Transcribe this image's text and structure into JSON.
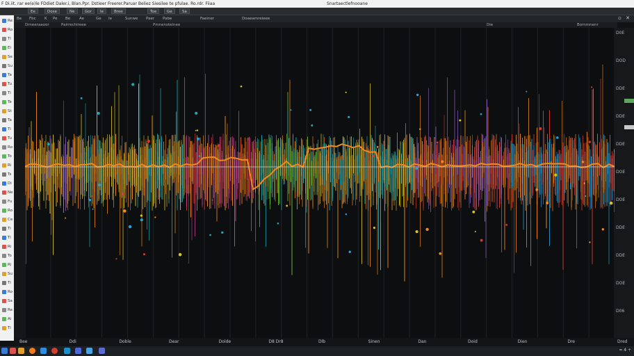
{
  "menubar": {
    "left_text": "F Di.iit. rar ee(e)le FDdiet Daler.i, Blan.Ppr. Dstieer Freerer.Paruar Beliez Siesilee te pfulae. Ro.rdr. Fiiaa",
    "center_title": "Snartaectlefnooane"
  },
  "toolbar": {
    "buttons": [
      "Ee",
      "Dose",
      "Ne",
      "Gor",
      "Ie",
      "Bree",
      "Toe",
      "Ge",
      "Sa"
    ]
  },
  "toolbar2": {
    "items": [
      "Be",
      "Fbc",
      "K",
      "Pe",
      "Be",
      "Ae",
      "Ge",
      "Ie",
      "Sunwe",
      "Paer",
      "Pabe",
      "Faeiner",
      "Doaeamreieee"
    ]
  },
  "ruler": {
    "left_label": "Drneeraaoor",
    "left_label2": "Pairrechireee",
    "center_label": "Pmnenstelnee",
    "mid_label": "Die",
    "right_label": "Bornmnenr"
  },
  "leftbar": {
    "labels": [
      "Re",
      "Ro",
      "Ti",
      "Ei",
      "Se",
      "Su",
      "Ta",
      "Tu",
      "Ti",
      "Te",
      "St",
      "Ta",
      "Ti",
      "Tu",
      "Ro",
      "To",
      "Ri",
      "Ts",
      "Di",
      "Ne",
      "Fu",
      "Ro",
      "Ce",
      "Ti",
      "Ti",
      "Ri",
      "To",
      "Ri",
      "Su",
      "Ti",
      "Ro",
      "Sa",
      "Re",
      "Ai",
      "Ti"
    ]
  },
  "rightpanel": {
    "labels": [
      "D0E",
      "DOD",
      "DDE",
      "DDE",
      "DDE",
      "DOE",
      "DOE",
      "DDE",
      "DDE",
      "DOE",
      "D06"
    ]
  },
  "bottom_axis": {
    "labels": [
      "Bee",
      "Ddi",
      "Doble",
      "Dear",
      "Dolde",
      "D8 Dr8",
      "Dlb",
      "Sinen",
      "Dan",
      "Doid",
      "Dien",
      "Dre",
      "Dred"
    ]
  },
  "taskbar": {
    "right_text": "≈ 4 ÷"
  },
  "colors": {
    "blue": "#2a9fd6",
    "teal": "#1fa7b3",
    "orange": "#f08a1c",
    "red": "#d63a2e",
    "yellow": "#d9c12a",
    "green": "#6cbf3a",
    "purple": "#8a5cc7",
    "pink": "#c9478f"
  }
}
